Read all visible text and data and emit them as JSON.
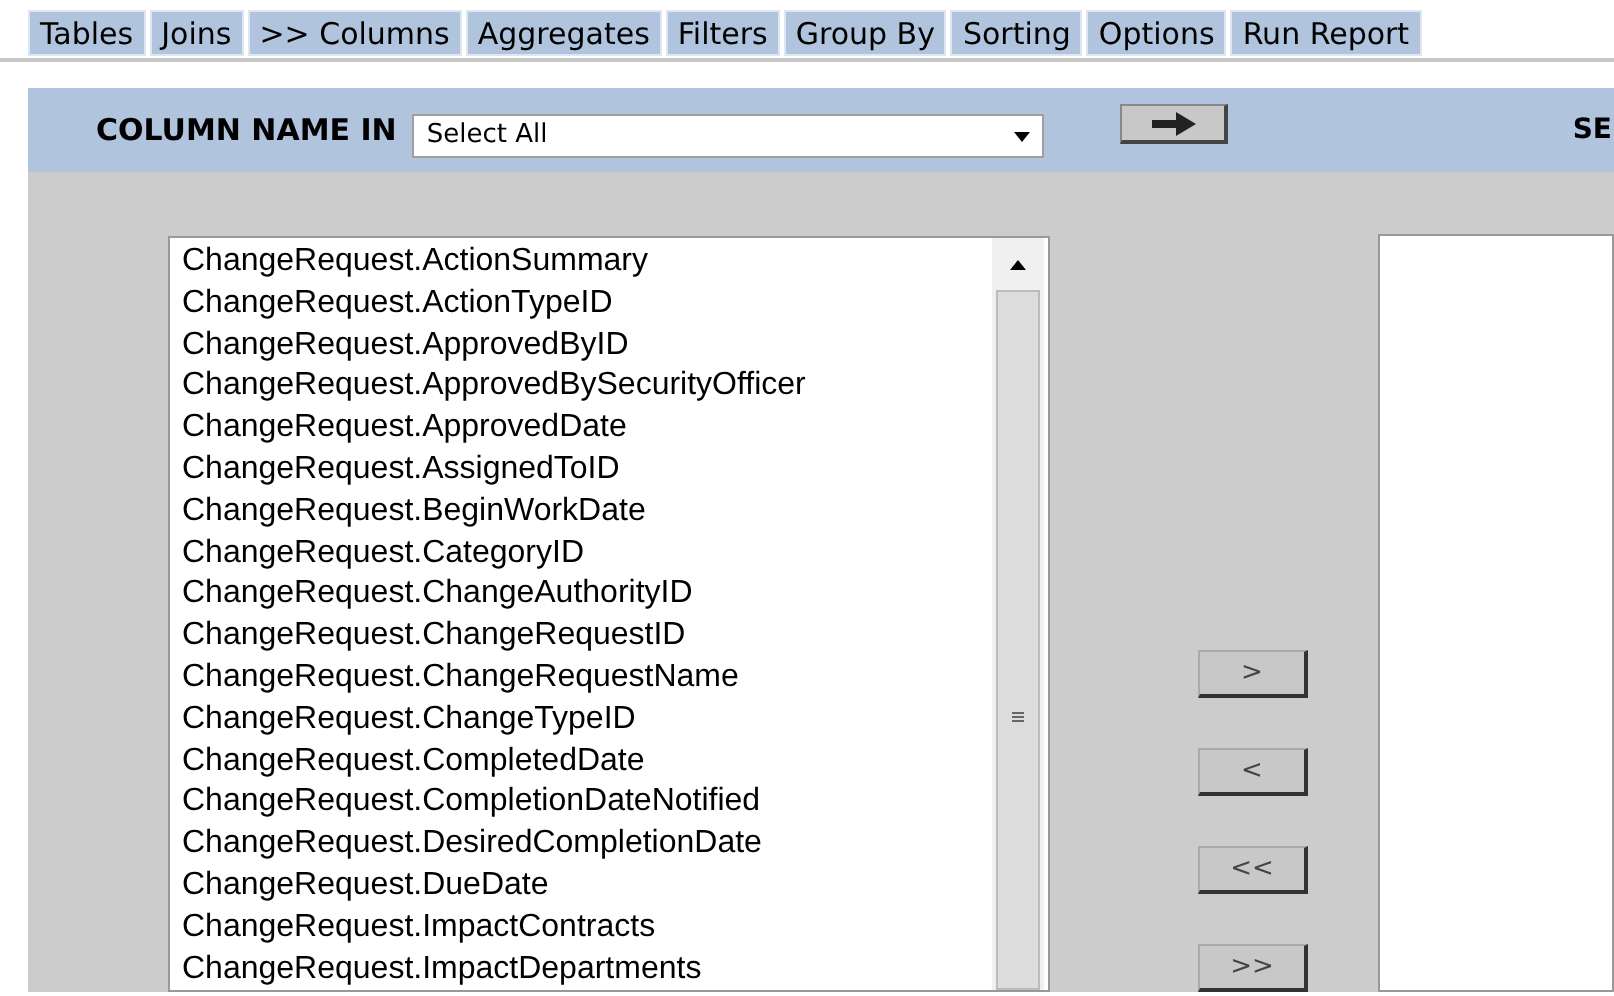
{
  "tabs": [
    "Tables",
    "Joins",
    ">> Columns",
    "Aggregates",
    "Filters",
    "Group By",
    "Sorting",
    "Options",
    "Run Report"
  ],
  "header": {
    "label": "COLUMN NAME IN",
    "select_value": "Select All",
    "right_label": "SE"
  },
  "available_columns": [
    "ChangeRequest.ActionSummary",
    "ChangeRequest.ActionTypeID",
    "ChangeRequest.ApprovedByID",
    "ChangeRequest.ApprovedBySecurityOfficer",
    "ChangeRequest.ApprovedDate",
    "ChangeRequest.AssignedToID",
    "ChangeRequest.BeginWorkDate",
    "ChangeRequest.CategoryID",
    "ChangeRequest.ChangeAuthorityID",
    "ChangeRequest.ChangeRequestID",
    "ChangeRequest.ChangeRequestName",
    "ChangeRequest.ChangeTypeID",
    "ChangeRequest.CompletedDate",
    "ChangeRequest.CompletionDateNotified",
    "ChangeRequest.DesiredCompletionDate",
    "ChangeRequest.DueDate",
    "ChangeRequest.ImpactContracts",
    "ChangeRequest.ImpactDepartments"
  ],
  "move_buttons": [
    ">",
    "<",
    "<<",
    ">>"
  ]
}
